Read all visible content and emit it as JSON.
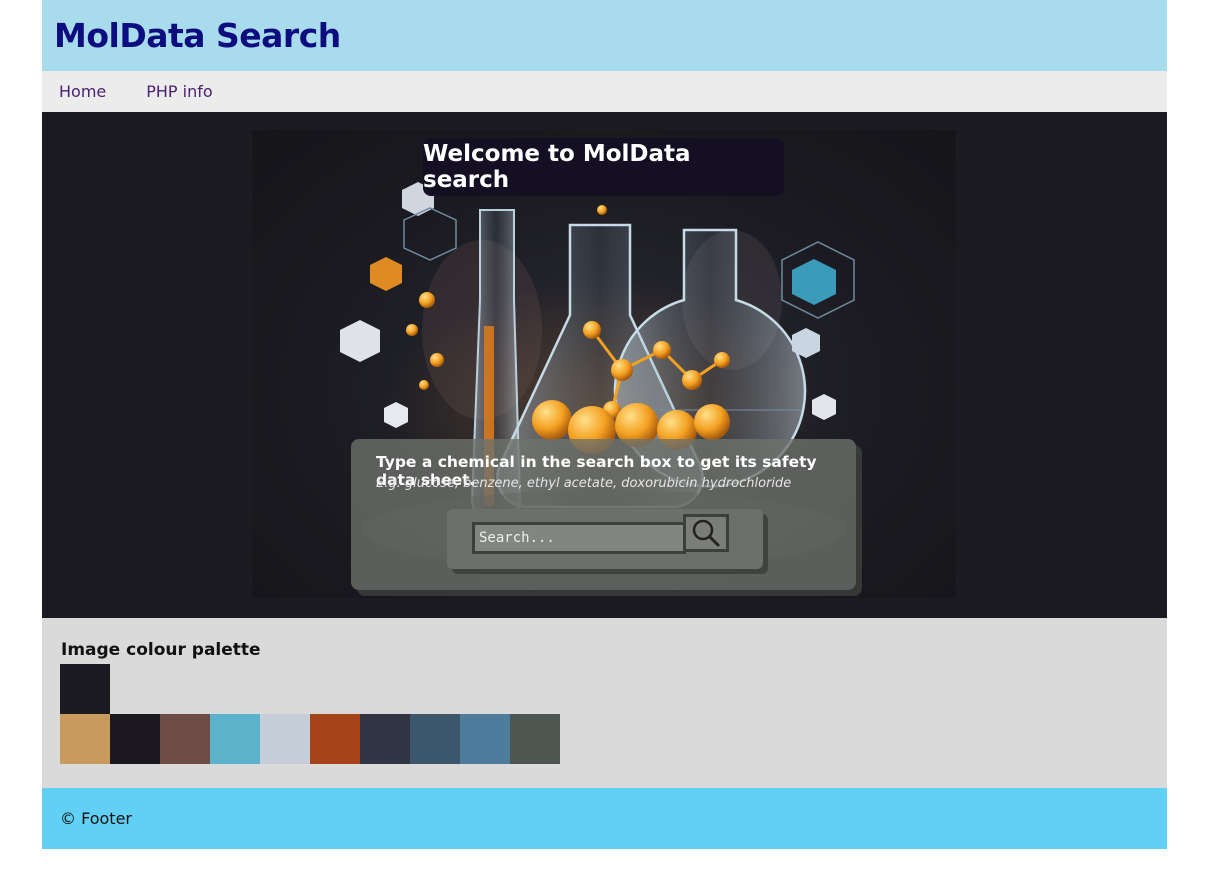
{
  "header": {
    "title": "MolData Search"
  },
  "nav": {
    "items": [
      {
        "label": "Home"
      },
      {
        "label": "PHP info"
      }
    ]
  },
  "hero": {
    "welcome": "Welcome to MolData search",
    "instruction": "Type a chemical in the search box to get its safety data sheet.",
    "example": "E.g. glucose, benzene, ethyl acetate, doxorubicin hydrochloride",
    "search": {
      "placeholder": "Search...",
      "value": "",
      "button_icon": "search-icon"
    }
  },
  "palette": {
    "title": "Image colour palette",
    "dominant": "#1b1a20",
    "colors": [
      "#c99a5e",
      "#1b1820",
      "#6e4d47",
      "#5bb3cb",
      "#c6cfd9",
      "#a54418",
      "#303443",
      "#3c566c",
      "#4d7c9c",
      "#4d5651"
    ]
  },
  "footer": {
    "text": "© Footer"
  }
}
